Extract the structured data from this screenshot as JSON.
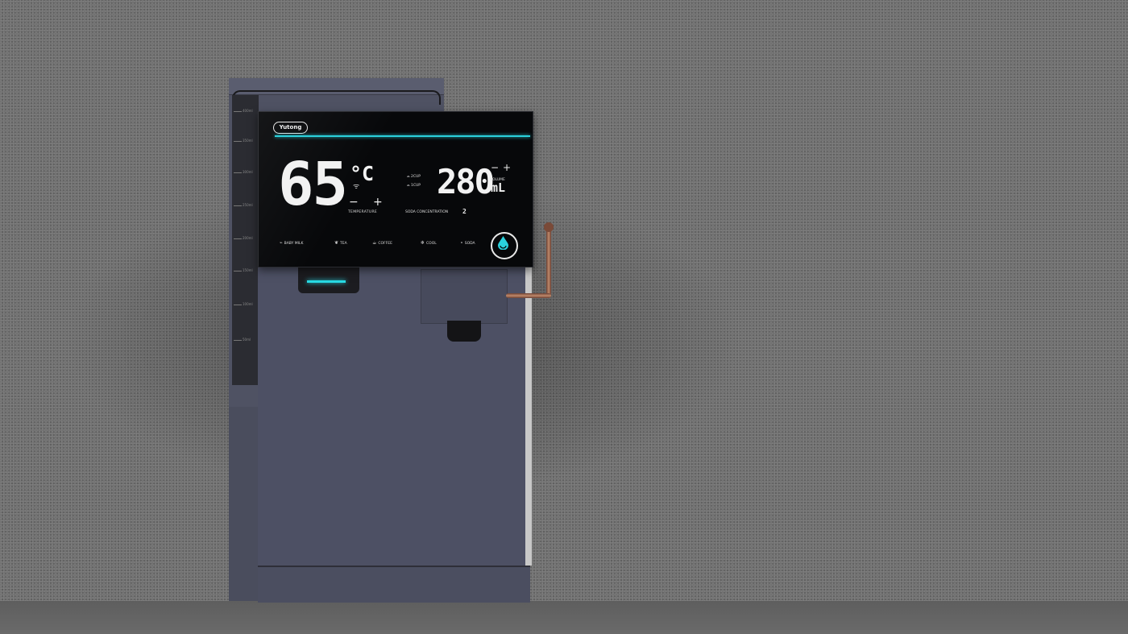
{
  "brand": {
    "logo": "Yutong"
  },
  "display": {
    "temperature": {
      "value": "65",
      "unit": "°C",
      "minus": "−",
      "plus": "+",
      "label": "TEMPERATURE"
    },
    "cups": [
      {
        "label": "2CUP"
      },
      {
        "label": "1CUP"
      }
    ],
    "volume": {
      "value": "280",
      "unit": "mL",
      "minus": "−",
      "plus": "+",
      "label": "VOLUME"
    },
    "soda": {
      "label": "SODA CONCENTRATION",
      "value": "2"
    },
    "modes": [
      {
        "label": "BABY MILK",
        "icon": "baby-bottle-icon"
      },
      {
        "label": "TEA",
        "icon": "tea-leaf-icon"
      },
      {
        "label": "COFFEE",
        "icon": "coffee-cup-icon"
      },
      {
        "label": "COOL",
        "icon": "snowflake-icon"
      },
      {
        "label": "SODA",
        "icon": "bubbles-icon"
      }
    ],
    "dispense_icon": "water-drop-icon"
  },
  "tank_marks": [
    "400ml",
    "350ml",
    "300ml",
    "250ml",
    "200ml",
    "150ml",
    "100ml",
    "50ml"
  ],
  "colors": {
    "accent": "#2ad1dc",
    "body": "#4d5064",
    "panel": "#07080a",
    "pipe": "#b07a5c",
    "wall": "#707070"
  }
}
